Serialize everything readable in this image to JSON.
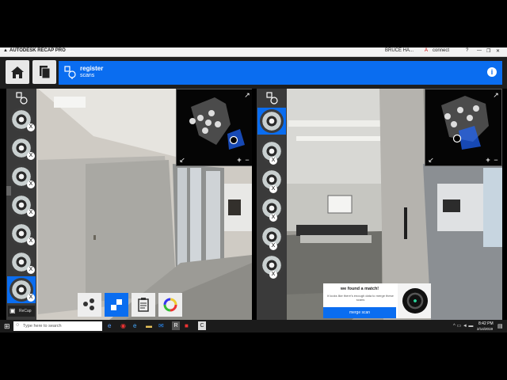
{
  "app": {
    "title": "AUTODESK RECAP PRO",
    "user": "BRUCE HA...",
    "connect": "connect",
    "help": "?",
    "window_controls": [
      "—",
      "❐",
      "✕"
    ]
  },
  "header": {
    "home_icon": "home-icon",
    "copy_icon": "copy-icon",
    "register_icon": "register-scans-icon",
    "title": "register",
    "subtitle": "scans",
    "info_label": "i"
  },
  "left_view": {
    "strip_badge": "X",
    "thumb_count": 7,
    "bottom_label": "ReCap",
    "minimap_plus": "+",
    "minimap_minus": "−",
    "tools": [
      "scatter-icon",
      "grid-icon",
      "clipboard-icon",
      "color-wheel-icon"
    ]
  },
  "right_view": {
    "strip_badge": "X",
    "thumb_count": 6,
    "minimap_plus": "+",
    "minimap_minus": "−",
    "match": {
      "title": "we found a match!",
      "body": "it looks like there's enough data to merge these scans",
      "button": "merge scan"
    }
  },
  "taskbar": {
    "search_placeholder": "Type here to search",
    "time": "8:42 PM",
    "date": "2/14/2019"
  }
}
